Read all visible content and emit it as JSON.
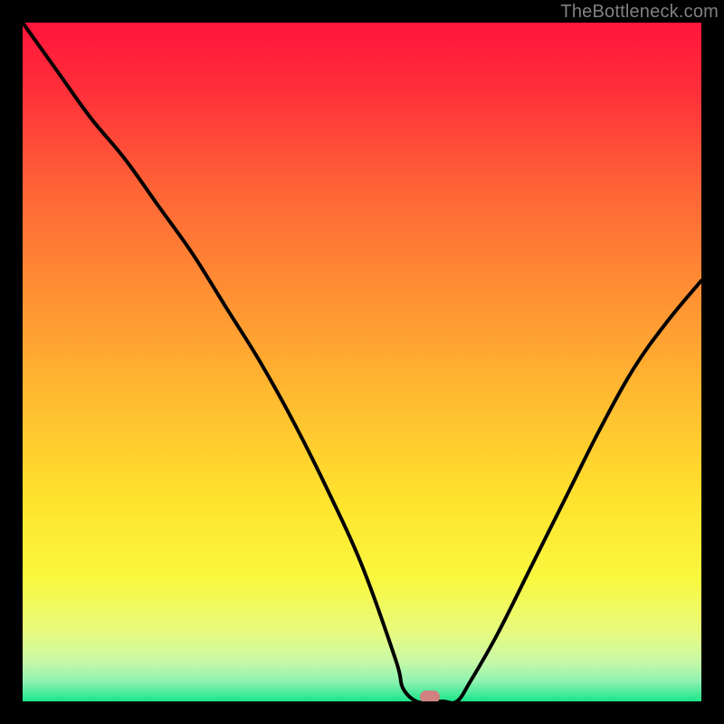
{
  "watermark": "TheBottleneck.com",
  "chart_data": {
    "type": "line",
    "title": "",
    "xlabel": "",
    "ylabel": "",
    "xlim": [
      0,
      100
    ],
    "ylim": [
      0,
      100
    ],
    "x": [
      0,
      5,
      10,
      15,
      20,
      25,
      30,
      35,
      40,
      45,
      50,
      55,
      56,
      58,
      60,
      62,
      64,
      66,
      70,
      75,
      80,
      85,
      90,
      95,
      100
    ],
    "values": [
      100,
      93,
      86,
      80,
      73,
      66,
      58,
      50,
      41,
      31,
      20,
      6,
      2,
      0,
      0,
      0,
      0,
      3,
      10,
      20,
      30,
      40,
      49,
      56,
      62
    ],
    "marker_x": 60,
    "gradient_stops": [
      {
        "offset": 0,
        "color": "#ff153b"
      },
      {
        "offset": 10,
        "color": "#ff2f3a"
      },
      {
        "offset": 25,
        "color": "#ff6536"
      },
      {
        "offset": 40,
        "color": "#ff9033"
      },
      {
        "offset": 55,
        "color": "#ffba30"
      },
      {
        "offset": 70,
        "color": "#ffe22d"
      },
      {
        "offset": 82,
        "color": "#f9f83f"
      },
      {
        "offset": 90,
        "color": "#e6fa80"
      },
      {
        "offset": 94,
        "color": "#c9f9a6"
      },
      {
        "offset": 97,
        "color": "#8ff2b1"
      },
      {
        "offset": 100,
        "color": "#1be58b"
      }
    ]
  }
}
